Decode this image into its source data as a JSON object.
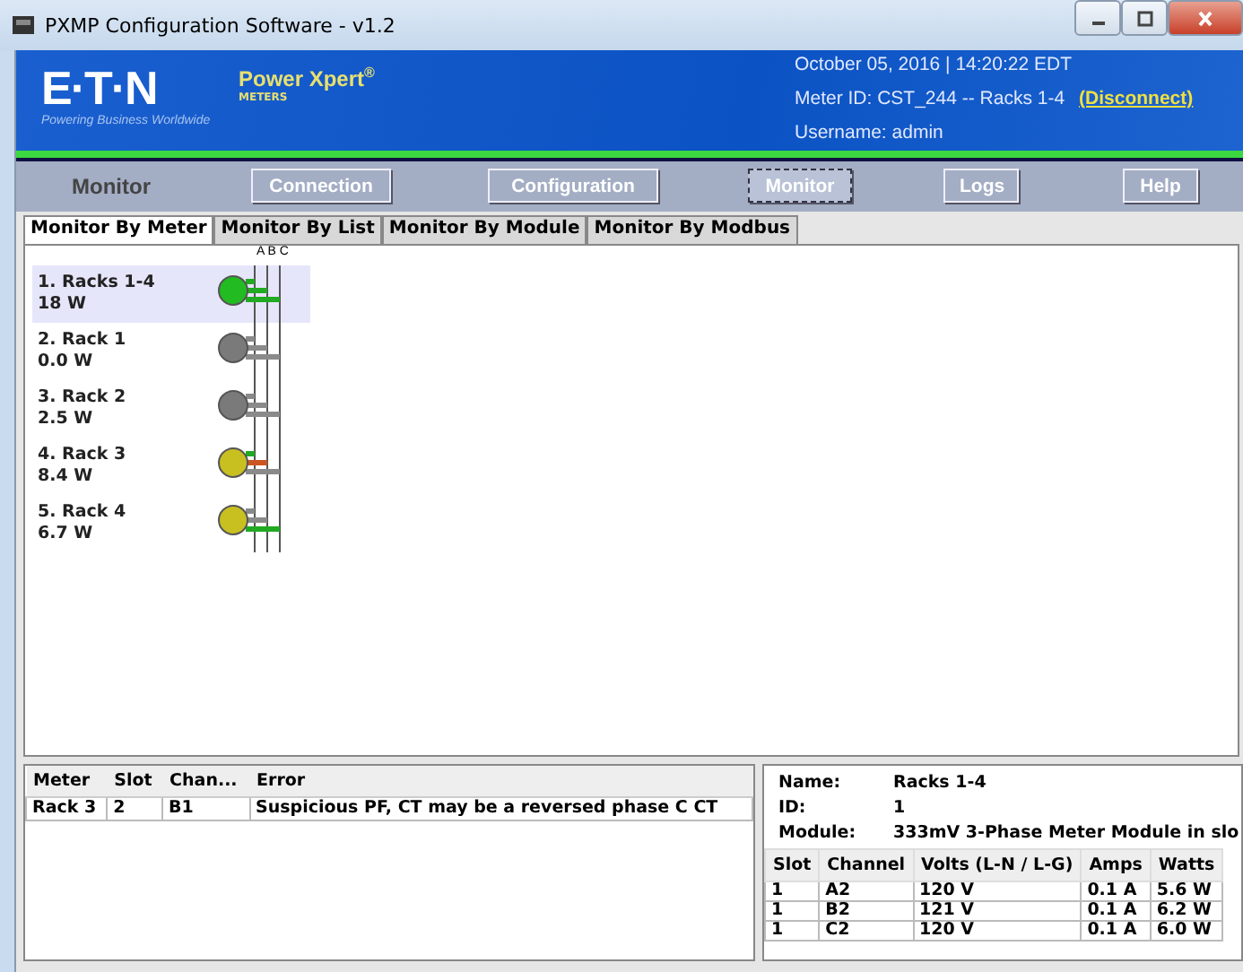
{
  "window": {
    "title": "PXMP Configuration Software - v1.2"
  },
  "header": {
    "logo": "E·T·N",
    "logo_tagline": "Powering Business Worldwide",
    "product": "Power Xpert",
    "product_mark": "®",
    "product_sub": "METERS",
    "datetime": "October 05, 2016 | 14:20:22 EDT",
    "meter_id": "Meter ID: CST_244 -- Racks 1-4",
    "disconnect": "(Disconnect)",
    "username": "Username: admin"
  },
  "nav": {
    "section": "Monitor",
    "buttons": [
      {
        "label": "Connection",
        "selected": false
      },
      {
        "label": "Configuration",
        "selected": false
      },
      {
        "label": "Monitor",
        "selected": true
      },
      {
        "label": "Logs",
        "selected": false
      },
      {
        "label": "Help",
        "selected": false
      }
    ]
  },
  "tabs": [
    {
      "label": "Monitor By Meter",
      "selected": true
    },
    {
      "label": "Monitor By List",
      "selected": false
    },
    {
      "label": "Monitor By Module",
      "selected": false
    },
    {
      "label": "Monitor By Modbus",
      "selected": false
    }
  ],
  "bus_labels": "A B C",
  "meters": [
    {
      "name": "1. Racks 1-4",
      "watts": "18 W",
      "selected": true,
      "color": "#22bb22",
      "phases": [
        {
          "color": "#22aa22"
        },
        {
          "color": "#22aa22"
        },
        {
          "color": "#22aa22"
        }
      ]
    },
    {
      "name": "2. Rack 1",
      "watts": "0.0 W",
      "selected": false,
      "color": "#7a7a7a",
      "phases": [
        {
          "color": "#8a8a8a"
        },
        {
          "color": "#8a8a8a"
        },
        {
          "color": "#8a8a8a"
        }
      ]
    },
    {
      "name": "3. Rack 2",
      "watts": "2.5 W",
      "selected": false,
      "color": "#7a7a7a",
      "phases": [
        {
          "color": "#8a8a8a"
        },
        {
          "color": "#8a8a8a"
        },
        {
          "color": "#8a8a8a"
        }
      ]
    },
    {
      "name": "4. Rack 3",
      "watts": "8.4 W",
      "selected": false,
      "color": "#c8c020",
      "phases": [
        {
          "color": "#22aa22"
        },
        {
          "color": "#cc5522"
        },
        {
          "color": "#8a8a8a"
        }
      ]
    },
    {
      "name": "5. Rack 4",
      "watts": "6.7 W",
      "selected": false,
      "color": "#c8c020",
      "phases": [
        {
          "color": "#8a8a8a"
        },
        {
          "color": "#8a8a8a"
        },
        {
          "color": "#22aa22"
        }
      ]
    }
  ],
  "errors": {
    "columns": [
      "Meter",
      "Slot",
      "Chan...",
      "Error"
    ],
    "rows": [
      [
        "Rack 3",
        "2",
        "B1",
        "Suspicious PF, CT may be a reversed phase C CT"
      ]
    ]
  },
  "details": {
    "fields": [
      {
        "label": "Name:",
        "value": "Racks 1-4"
      },
      {
        "label": "ID:",
        "value": "1"
      },
      {
        "label": "Module:",
        "value": "333mV 3-Phase Meter Module in slo"
      }
    ],
    "columns": [
      "Slot",
      "Channel",
      "Volts (L-N / L-G)",
      "Amps",
      "Watts"
    ],
    "rows": [
      [
        "1",
        "A2",
        "120 V",
        "0.1 A",
        "5.6 W"
      ],
      [
        "1",
        "B2",
        "121 V",
        "0.1 A",
        "6.2 W"
      ],
      [
        "1",
        "C2",
        "120 V",
        "0.1 A",
        "6.0 W"
      ]
    ]
  }
}
